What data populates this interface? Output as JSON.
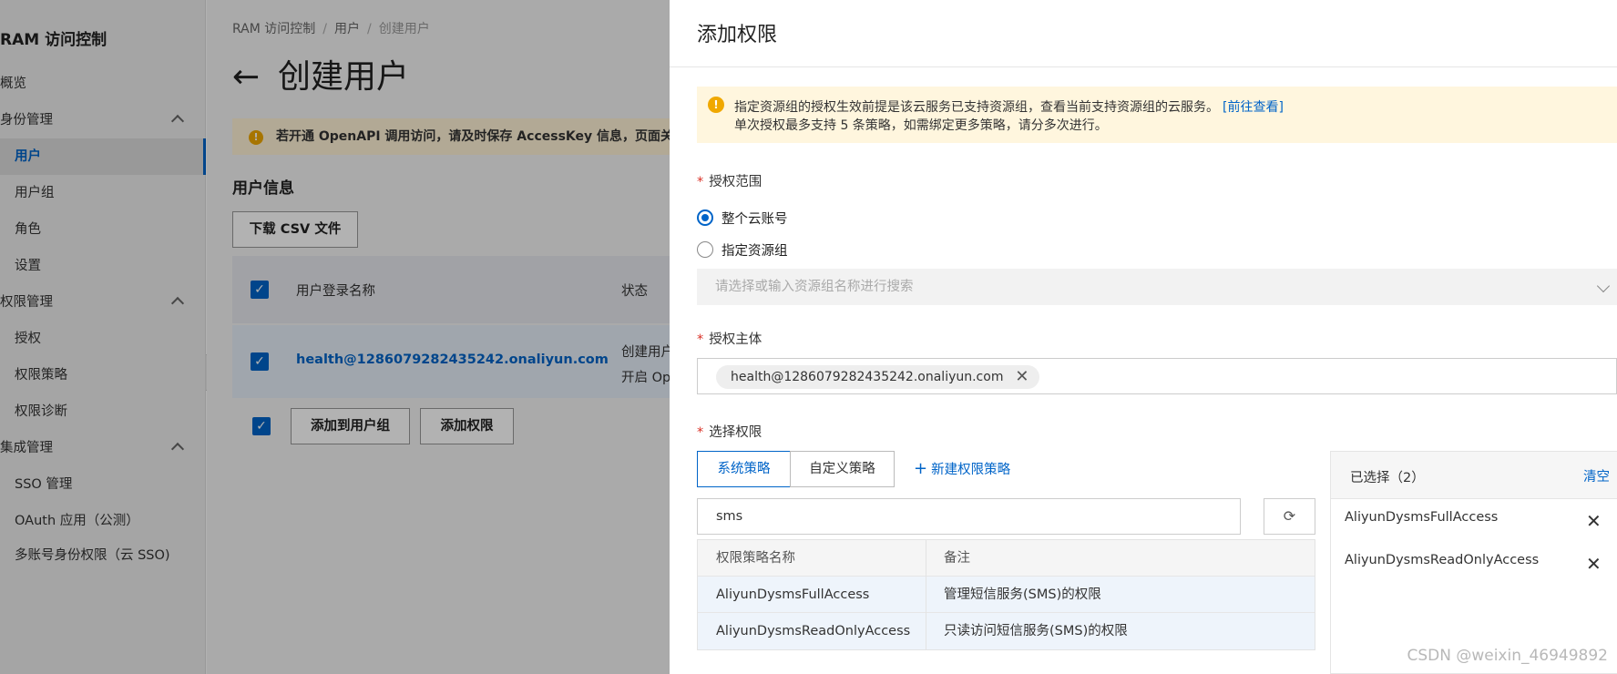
{
  "sidebar": {
    "title": "RAM 访问控制",
    "items": [
      {
        "label": "概览"
      },
      {
        "label": "身份管理"
      },
      {
        "label": "用户"
      },
      {
        "label": "用户组"
      },
      {
        "label": "角色"
      },
      {
        "label": "设置"
      },
      {
        "label": "权限管理"
      },
      {
        "label": "授权"
      },
      {
        "label": "权限策略"
      },
      {
        "label": "权限诊断"
      },
      {
        "label": "集成管理"
      },
      {
        "label": "SSO 管理"
      },
      {
        "label": "OAuth 应用（公测）"
      },
      {
        "label": "多账号身份权限（云 SSO)"
      }
    ],
    "collapse_glyph": "‹"
  },
  "main": {
    "breadcrumb": [
      "RAM 访问控制",
      "用户",
      "创建用户"
    ],
    "back_glyph": "←",
    "title": "创建用户",
    "warning": "若开通 OpenAPI 调用访问，请及时保存 AccessKey 信息，页面关",
    "section_title": "用户信息",
    "download_button": "下载 CSV 文件",
    "table": {
      "col_login": "用户登录名称",
      "col_status": "状态",
      "row_login": "health@1286079282435242.onaliyun.com",
      "row_status_1": "创建用户",
      "row_status_2": "开启 Op"
    },
    "add_to_group_button": "添加到用户组",
    "add_permission_button": "添加权限"
  },
  "drawer": {
    "title": "添加权限",
    "notice": {
      "line1": "指定资源组的授权生效前提是该云服务已支持资源组，查看当前支持资源组的云服务。",
      "link": "[前往查看]",
      "line2": "单次授权最多支持 5 条策略，如需绑定更多策略，请分多次进行。"
    },
    "scope": {
      "label": "授权范围",
      "options": [
        "整个云账号",
        "指定资源组"
      ],
      "selected": "整个云账号",
      "resource_group_placeholder": "请选择或输入资源组名称进行搜索"
    },
    "principal": {
      "label": "授权主体",
      "tag": "health@1286079282435242.onaliyun.com"
    },
    "permissions": {
      "label": "选择权限",
      "tabs": [
        "系统策略",
        "自定义策略"
      ],
      "active_tab": "系统策略",
      "new_policy": "新建权限策略",
      "search_value": "sms",
      "columns": [
        "权限策略名称",
        "备注"
      ],
      "rows": [
        {
          "name": "AliyunDysmsFullAccess",
          "note": "管理短信服务(SMS)的权限"
        },
        {
          "name": "AliyunDysmsReadOnlyAccess",
          "note": "只读访问短信服务(SMS)的权限"
        }
      ]
    },
    "selected": {
      "title": "已选择（2）",
      "clear": "清空",
      "items": [
        "AliyunDysmsFullAccess",
        "AliyunDysmsReadOnlyAccess"
      ]
    }
  },
  "watermark": "CSDN @weixin_46949892",
  "colors": {
    "accent": "#0064c8",
    "warning": "#f0a800",
    "required": "#d93026"
  }
}
